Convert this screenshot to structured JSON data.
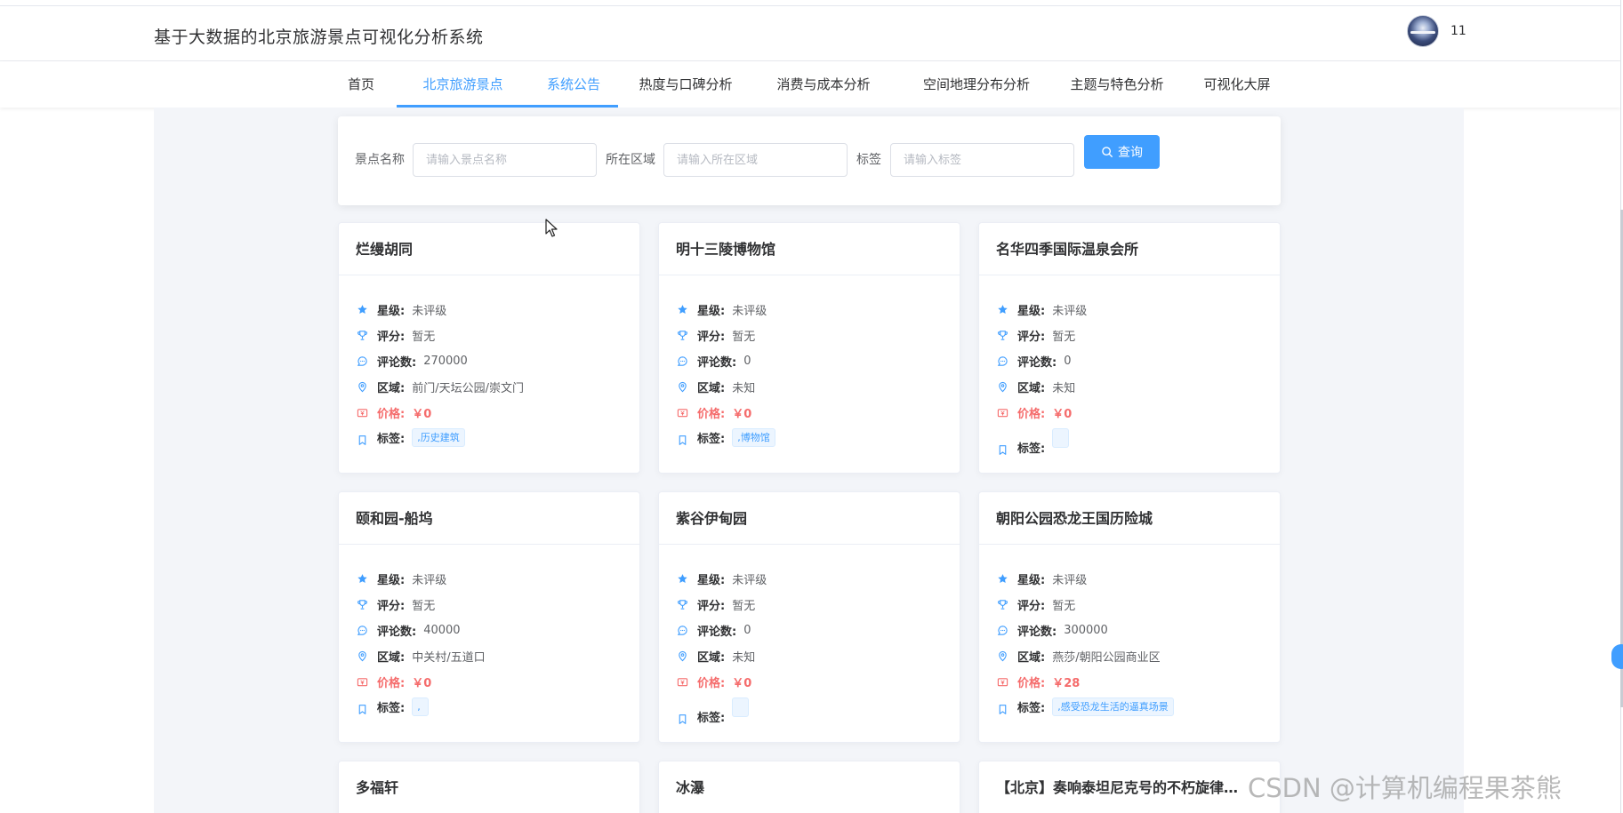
{
  "header": {
    "title": "基于大数据的北京旅游景点可视化分析系统",
    "username": "11"
  },
  "nav": {
    "items": [
      {
        "label": "首页"
      },
      {
        "label": "北京旅游景点"
      },
      {
        "label": "系统公告"
      },
      {
        "label": "热度与口碑分析"
      },
      {
        "label": "消费与成本分析"
      },
      {
        "label": "空间地理分布分析"
      },
      {
        "label": "主题与特色分析"
      },
      {
        "label": "可视化大屏"
      }
    ],
    "active": "北京旅游景点"
  },
  "search": {
    "name_label": "景点名称",
    "name_placeholder": "请输入景点名称",
    "region_label": "所在区域",
    "region_placeholder": "请输入所在区域",
    "tag_label": "标签",
    "tag_placeholder": "请输入标签",
    "button_label": "查询"
  },
  "field_labels": {
    "star": "星级:",
    "rating": "评分:",
    "reviews": "评论数:",
    "region": "区域:",
    "price": "价格:",
    "tags": "标签:"
  },
  "cards": [
    {
      "name": "烂缦胡同",
      "star": "未评级",
      "rating": "暂无",
      "reviews": "270000",
      "region": "前门/天坛公园/崇文门",
      "price": "￥0",
      "tag": ",历史建筑"
    },
    {
      "name": "明十三陵博物馆",
      "star": "未评级",
      "rating": "暂无",
      "reviews": "0",
      "region": "未知",
      "price": "￥0",
      "tag": ",博物馆"
    },
    {
      "name": "名华四季国际温泉会所",
      "star": "未评级",
      "rating": "暂无",
      "reviews": "0",
      "region": "未知",
      "price": "￥0",
      "tag": ""
    },
    {
      "name": "颐和园-船坞",
      "star": "未评级",
      "rating": "暂无",
      "reviews": "40000",
      "region": "中关村/五道口",
      "price": "￥0",
      "tag": ","
    },
    {
      "name": "紫谷伊甸园",
      "star": "未评级",
      "rating": "暂无",
      "reviews": "0",
      "region": "未知",
      "price": "￥0",
      "tag": ""
    },
    {
      "name": "朝阳公园恐龙王国历险城",
      "star": "未评级",
      "rating": "暂无",
      "reviews": "300000",
      "region": "燕莎/朝阳公园商业区",
      "price": "￥28",
      "tag": ",感受恐龙生活的逼真场景"
    },
    {
      "name": "多福轩"
    },
    {
      "name": "冰瀑"
    },
    {
      "name": "【北京】奏响泰坦尼克号的不朽旋律…"
    }
  ],
  "watermark": "CSDN @计算机编程果茶熊",
  "colors": {
    "accent": "#409eff",
    "price": "#f56c6c",
    "page_bg": "#f3f5f9"
  }
}
